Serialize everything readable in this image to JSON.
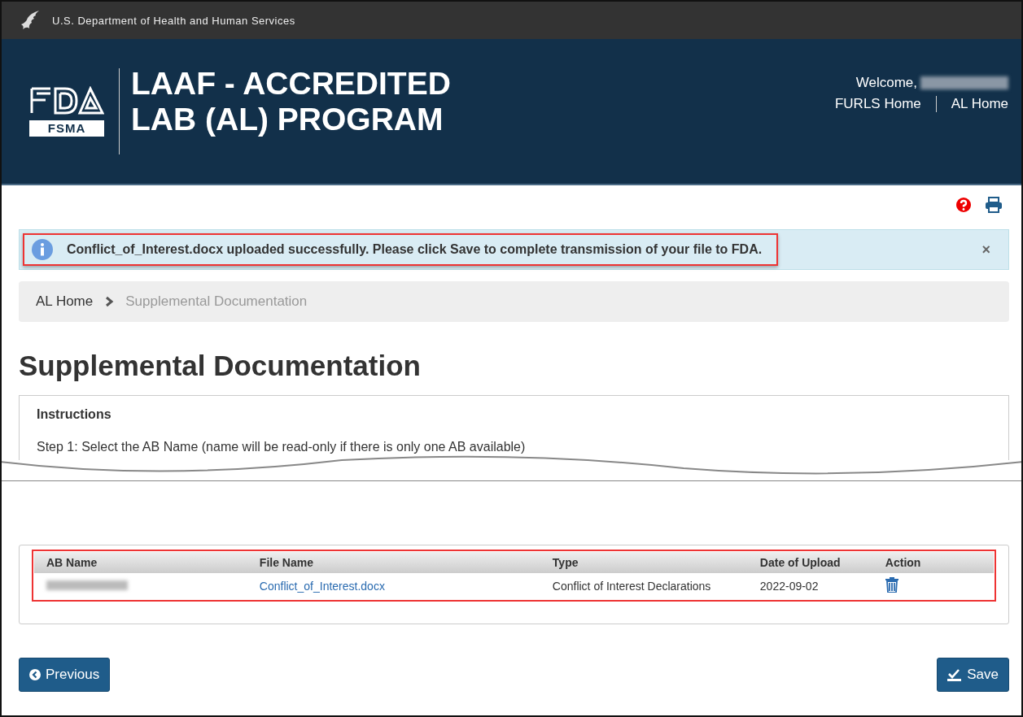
{
  "agency_bar": {
    "text": "U.S. Department of Health and Human Services"
  },
  "header": {
    "logo_text": "FSMA",
    "title_lines": [
      "LAAF - ACCREDITED",
      "LAB (AL) PROGRAM"
    ],
    "welcome": "Welcome,",
    "links": [
      "FURLS Home",
      "AL Home"
    ]
  },
  "alert": {
    "message": "Conflict_of_Interest.docx uploaded successfully. Please click Save to complete transmission of your file to FDA.",
    "close": "×"
  },
  "breadcrumb": [
    {
      "label": "AL Home",
      "current": false
    },
    {
      "label": "Supplemental Documentation",
      "current": true
    }
  ],
  "page_title": "Supplemental Documentation",
  "instructions": {
    "heading": "Instructions",
    "step": "Step 1: Select the AB Name (name will be read-only if there is only one AB available)"
  },
  "table": {
    "columns": [
      "AB Name",
      "File Name",
      "Type",
      "Date of Upload",
      "Action"
    ],
    "rows": [
      {
        "file_name": "Conflict_of_Interest.docx",
        "type": "Conflict of Interest Declarations",
        "date": "2022-09-02"
      }
    ]
  },
  "buttons": {
    "previous": "Previous",
    "save": "Save"
  }
}
